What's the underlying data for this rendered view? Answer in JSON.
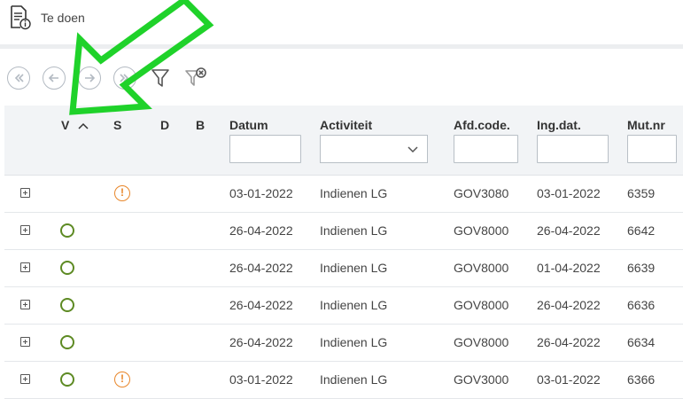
{
  "header": {
    "title": "Te doen",
    "icon": "document-info-icon"
  },
  "toolbar": {
    "buttons": [
      "first-page-icon",
      "previous-page-icon",
      "next-page-icon",
      "last-page-icon",
      "filter-icon",
      "clear-filter-icon"
    ]
  },
  "columns": {
    "v": "V",
    "s": "S",
    "d": "D",
    "b": "B",
    "datum": "Datum",
    "activiteit": "Activiteit",
    "afdcode": "Afd.code.",
    "ingdat": "Ing.dat.",
    "mutnr": "Mut.nr"
  },
  "rows": [
    {
      "v": "",
      "s": "warning",
      "datum": "03-01-2022",
      "activiteit": "Indienen LG",
      "afdcode": "GOV3080",
      "ingdat": "03-01-2022",
      "mutnr": "6359"
    },
    {
      "v": "ok",
      "s": "",
      "datum": "26-04-2022",
      "activiteit": "Indienen LG",
      "afdcode": "GOV8000",
      "ingdat": "26-04-2022",
      "mutnr": "6642"
    },
    {
      "v": "ok",
      "s": "",
      "datum": "26-04-2022",
      "activiteit": "Indienen LG",
      "afdcode": "GOV8000",
      "ingdat": "01-04-2022",
      "mutnr": "6639"
    },
    {
      "v": "ok",
      "s": "",
      "datum": "26-04-2022",
      "activiteit": "Indienen LG",
      "afdcode": "GOV8000",
      "ingdat": "26-04-2022",
      "mutnr": "6636"
    },
    {
      "v": "ok",
      "s": "",
      "datum": "26-04-2022",
      "activiteit": "Indienen LG",
      "afdcode": "GOV8000",
      "ingdat": "26-04-2022",
      "mutnr": "6634"
    },
    {
      "v": "ok",
      "s": "warning",
      "datum": "03-01-2022",
      "activiteit": "Indienen LG",
      "afdcode": "GOV3000",
      "ingdat": "03-01-2022",
      "mutnr": "6366"
    }
  ],
  "warning_glyph": "!",
  "colors": {
    "ok": "#5d8a23",
    "warning": "#e8862a",
    "annotation_arrow": "#1fd22a"
  }
}
